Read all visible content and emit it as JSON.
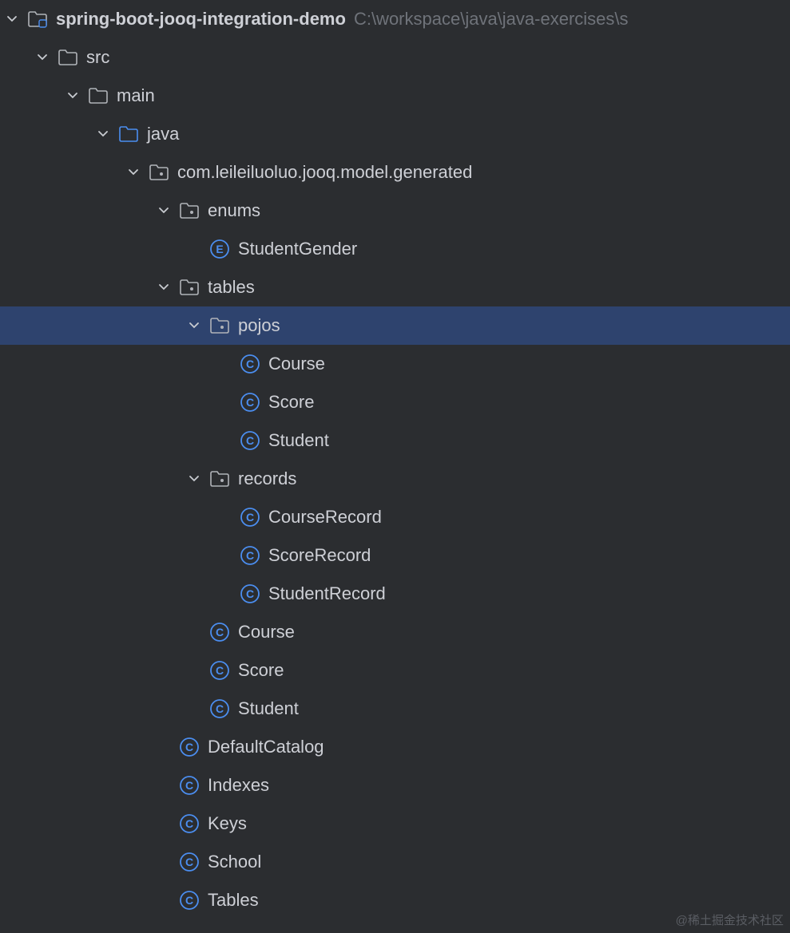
{
  "watermark": "@稀土掘金技术社区",
  "tree": {
    "root": {
      "label": "spring-boot-jooq-integration-demo",
      "path": "C:\\workspace\\java\\java-exercises\\s"
    },
    "src": {
      "label": "src"
    },
    "main": {
      "label": "main"
    },
    "java": {
      "label": "java"
    },
    "pkg": {
      "label": "com.leileiluoluo.jooq.model.generated"
    },
    "enums": {
      "label": "enums"
    },
    "enum_items": {
      "StudentGender": "StudentGender"
    },
    "tables": {
      "label": "tables"
    },
    "pojos": {
      "label": "pojos"
    },
    "pojo_items": {
      "Course": "Course",
      "Score": "Score",
      "Student": "Student"
    },
    "records": {
      "label": "records"
    },
    "record_items": {
      "CourseRecord": "CourseRecord",
      "ScoreRecord": "ScoreRecord",
      "StudentRecord": "StudentRecord"
    },
    "table_items": {
      "Course": "Course",
      "Score": "Score",
      "Student": "Student"
    },
    "pkg_items": {
      "DefaultCatalog": "DefaultCatalog",
      "Indexes": "Indexes",
      "Keys": "Keys",
      "School": "School",
      "Tables": "Tables"
    }
  }
}
